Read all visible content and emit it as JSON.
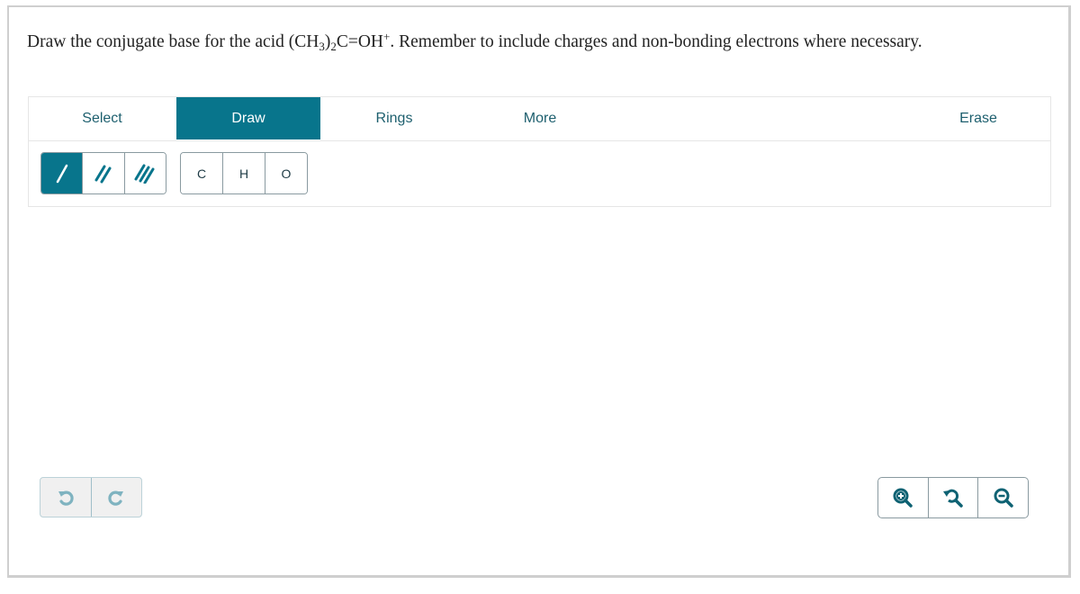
{
  "question": {
    "text_before": "Draw the conjugate base for the acid (CH",
    "sub1": "3",
    "text_mid1": ")",
    "sub2": "2",
    "text_mid2": "C=OH",
    "sup": "+",
    "text_after": ". Remember to include charges and non-bonding electrons where necessary."
  },
  "tabs": [
    {
      "label": "Select",
      "active": false
    },
    {
      "label": "Draw",
      "active": true
    },
    {
      "label": "Rings",
      "active": false
    },
    {
      "label": "More",
      "active": false
    },
    {
      "label": "Erase",
      "active": false
    }
  ],
  "bond_tools": [
    {
      "name": "single-bond",
      "icon": "single-bond-icon",
      "active": true
    },
    {
      "name": "double-bond",
      "icon": "double-bond-icon",
      "active": false
    },
    {
      "name": "triple-bond",
      "icon": "triple-bond-icon",
      "active": false
    }
  ],
  "atom_tools": [
    {
      "label": "C"
    },
    {
      "label": "H"
    },
    {
      "label": "O"
    }
  ],
  "history": [
    {
      "name": "undo",
      "icon": "undo-icon"
    },
    {
      "name": "redo",
      "icon": "redo-icon"
    }
  ],
  "zoom_controls": [
    {
      "name": "zoom-in",
      "icon": "zoom-in-icon"
    },
    {
      "name": "reset-zoom",
      "icon": "reset-zoom-icon"
    },
    {
      "name": "zoom-out",
      "icon": "zoom-out-icon"
    }
  ],
  "colors": {
    "accent": "#08758c",
    "tab_text": "#1d5f6e",
    "history_icon": "#7fb3c0",
    "zoom_icon": "#0f6273"
  }
}
